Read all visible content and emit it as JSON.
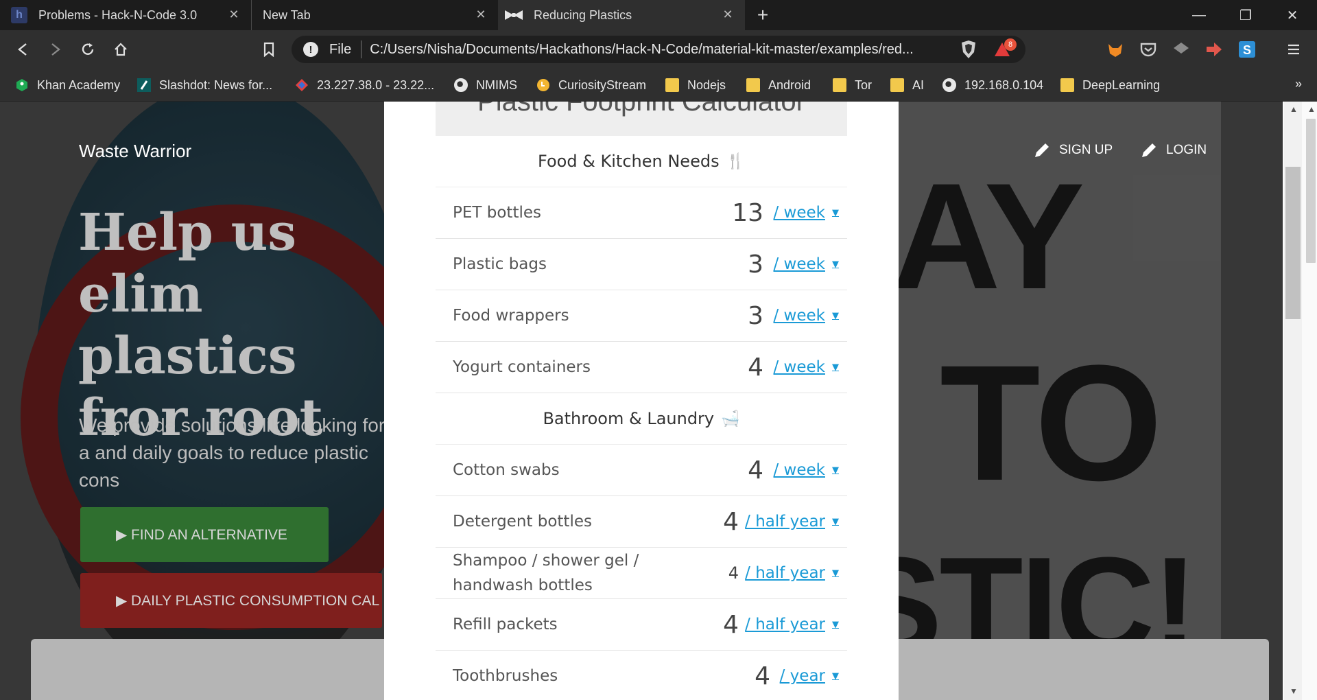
{
  "browser": {
    "tabs": [
      {
        "title": "Problems - Hack-N-Code 3.0",
        "active": false
      },
      {
        "title": "New Tab",
        "active": false
      },
      {
        "title": "Reducing Plastics",
        "active": true
      }
    ],
    "close_glyph": "✕",
    "new_tab_glyph": "+",
    "window": {
      "minimize": "—",
      "restore": "❐",
      "close": "✕"
    },
    "url_scheme_label": "File",
    "url": "C:/Users/Nisha/Documents/Hackathons/Hack-N-Code/material-kit-master/examples/red...",
    "rewards_badge": "8",
    "bookmarks": [
      {
        "label": "Khan Academy",
        "icon": "khan-icon"
      },
      {
        "label": "Slashdot: News for...",
        "icon": "slashdot-icon"
      },
      {
        "label": "23.227.38.0 - 23.22...",
        "icon": "diamond-icon"
      },
      {
        "label": "NMIMS",
        "icon": "globe-icon"
      },
      {
        "label": "CuriosityStream",
        "icon": "curiosity-icon"
      },
      {
        "label": "Nodejs",
        "icon": "folder-icon"
      },
      {
        "label": "Android",
        "icon": "folder-icon"
      },
      {
        "label": "Tor",
        "icon": "folder-icon"
      },
      {
        "label": "AI",
        "icon": "folder-icon"
      },
      {
        "label": "192.168.0.104",
        "icon": "globe-icon"
      },
      {
        "label": "DeepLearning",
        "icon": "folder-icon"
      }
    ],
    "bookmarks_more": "»"
  },
  "site": {
    "brand": "Waste Warrior",
    "nav": {
      "signup": "SIGN UP",
      "login": "LOGIN"
    },
    "hero_title": "Help us eliminate plastics from the root",
    "hero_title_visible": "Help us elim plastics fror root",
    "hero_sub": "We provide solutions like looking for a and daily goals to reduce plastic cons",
    "btn_alternative": "▶ FIND AN ALTERNATIVE",
    "btn_calculator": "▶ DAILY PLASTIC CONSUMPTION CAL",
    "poster_words": [
      "AY",
      "TO",
      "STIC!"
    ]
  },
  "calculator": {
    "title": "Plastic Footprint Calculator",
    "sections": [
      {
        "heading": "Food & Kitchen Needs",
        "emoji": "🍴",
        "items": [
          {
            "label": "PET bottles",
            "qty": "13",
            "unit": "/ week"
          },
          {
            "label": "Plastic bags",
            "qty": "3",
            "unit": "/ week"
          },
          {
            "label": "Food wrappers",
            "qty": "3",
            "unit": "/ week"
          },
          {
            "label": "Yogurt containers",
            "qty": "4",
            "unit": "/ week"
          }
        ]
      },
      {
        "heading": "Bathroom & Laundry",
        "emoji": "🛁",
        "items": [
          {
            "label": "Cotton swabs",
            "qty": "4",
            "unit": "/ week"
          },
          {
            "label": "Detergent bottles",
            "qty": "4",
            "unit": "/ half year"
          },
          {
            "label": "Shampoo / shower gel / handwash bottles",
            "qty": "4",
            "unit": "/ half year"
          },
          {
            "label": "Refill packets",
            "qty": "4",
            "unit": "/ half year"
          },
          {
            "label": "Toothbrushes",
            "qty": "4",
            "unit": "/ year"
          }
        ]
      }
    ],
    "caret": "▼"
  }
}
